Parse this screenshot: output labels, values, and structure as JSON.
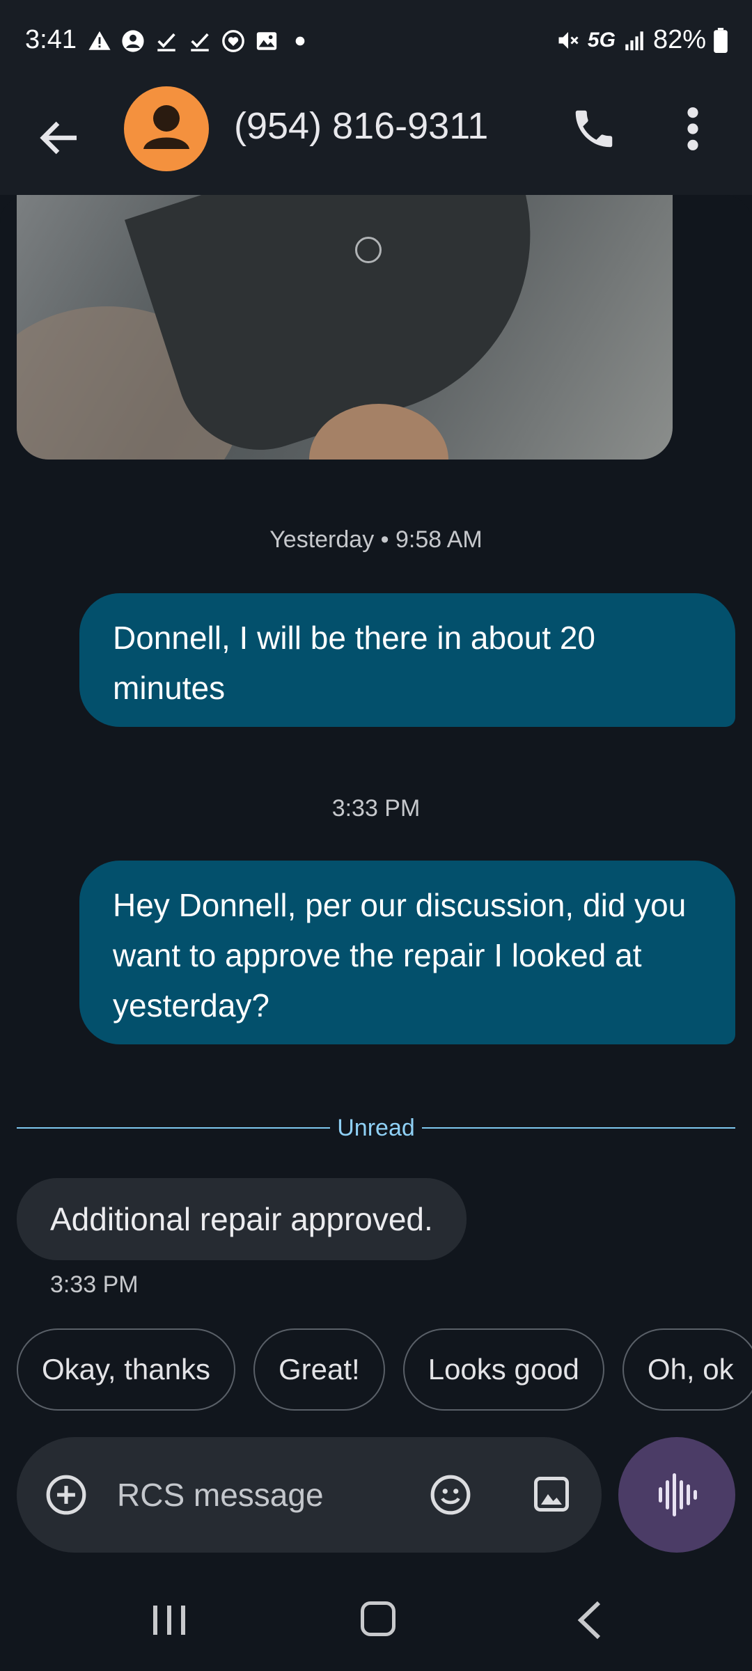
{
  "status_bar": {
    "time": "3:41",
    "network": "5G",
    "battery": "82%"
  },
  "header": {
    "contact_name": "(954) 816-9311",
    "avatar_color": "#f4913e"
  },
  "conversation": {
    "timestamp_1": "Yesterday • 9:58 AM",
    "message_1": "Donnell, I will be there in about 20 minutes",
    "timestamp_2": "3:33 PM",
    "message_2": "Hey Donnell, per our discussion, did you want to approve the repair I looked at yesterday?",
    "unread_label": "Unread",
    "incoming_message": "Additional repair approved.",
    "incoming_time": "3:33 PM",
    "outgoing_bubble_color": "#03506c"
  },
  "smart_replies": [
    "Okay, thanks",
    "Great!",
    "Looks good",
    "Oh, ok"
  ],
  "compose": {
    "placeholder": "RCS message"
  }
}
